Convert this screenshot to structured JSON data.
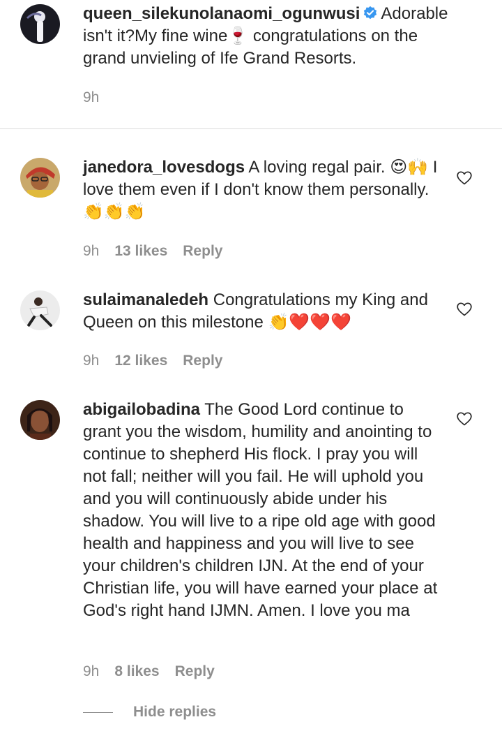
{
  "caption_comment": {
    "username": "queen_silekunolanaomi_ogunwusi",
    "verified": true,
    "text": "Adorable isn't it?My fine wine🍷 congratulations on the grand unvieling of Ife Grand Resorts.",
    "time": "9h"
  },
  "comments": [
    {
      "username": "janedora_lovesdogs",
      "text": "A loving regal pair. 😍🙌 I love them even if I don't know them personally. 👏👏👏",
      "time": "9h",
      "likes": "13 likes",
      "reply": "Reply"
    },
    {
      "username": "sulaimanaledeh",
      "text": "Congratulations my King and Queen on this milestone 👏❤️❤️❤️",
      "time": "9h",
      "likes": "12 likes",
      "reply": "Reply"
    },
    {
      "username": "abigailobadina",
      "text": "The Good Lord continue to grant you the wisdom, humility and anointing to continue to shepherd His flock. I pray you will not fall; neither will you fail. He will uphold you and you will continuously abide under his shadow. You will live to a ripe old age with good health and happiness and you will live to see your children's children IJN. At the end of your Christian life, you will have earned your place at God's right hand IJMN. Amen. I love you ma",
      "time": "9h",
      "likes": "8 likes",
      "reply": "Reply"
    }
  ],
  "hide_replies": "Hide replies",
  "icons": {
    "verified": "verified-badge-icon",
    "like": "heart-outline-icon"
  },
  "colors": {
    "text": "#262626",
    "secondary": "#8e8e8e",
    "verified": "#3897f0",
    "divider": "#dbdbdb"
  }
}
